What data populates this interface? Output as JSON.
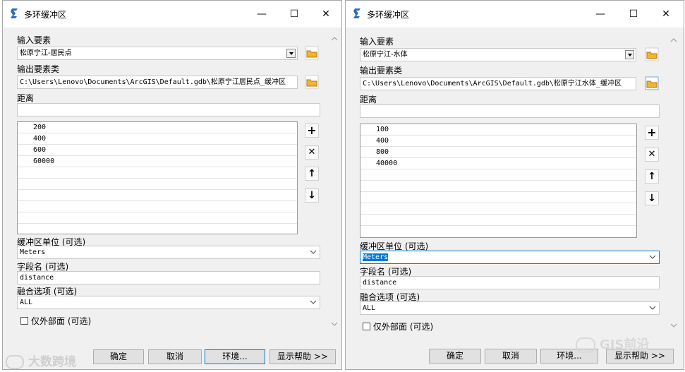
{
  "left": {
    "title": "多环缓冲区",
    "input_label": "输入要素",
    "input_value": "松原宁江-居民点",
    "output_label": "输出要素类",
    "output_value": "C:\\Users\\Lenovo\\Documents\\ArcGIS\\Default.gdb\\松原宁江居民点_缓冲区",
    "distance_label": "距离",
    "distance_value": "",
    "distances": [
      "200",
      "400",
      "600",
      "60000"
    ],
    "unit_label": "缓冲区单位 (可选)",
    "unit_value": "Meters",
    "field_label": "字段名 (可选)",
    "field_value": "distance",
    "dissolve_label": "融合选项 (可选)",
    "dissolve_value": "ALL",
    "outside_only_label": "仅外部面 (可选)",
    "ok": "确定",
    "cancel": "取消",
    "env": "环境...",
    "help": "显示帮助 >>"
  },
  "right": {
    "title": "多环缓冲区",
    "input_label": "输入要素",
    "input_value": "松原宁江-水体",
    "output_label": "输出要素类",
    "output_value": "C:\\Users\\Lenovo\\Documents\\ArcGIS\\Default.gdb\\松原宁江水体_缓冲区",
    "distance_label": "距离",
    "distance_value": "",
    "distances": [
      "100",
      "400",
      "800",
      "40000"
    ],
    "unit_label": "缓冲区单位 (可选)",
    "unit_value": "Meters",
    "field_label": "字段名 (可选)",
    "field_value": "distance",
    "dissolve_label": "融合选项 (可选)",
    "dissolve_value": "ALL",
    "outside_only_label": "仅外部面 (可选)",
    "ok": "确定",
    "cancel": "取消",
    "env": "环境...",
    "help": "显示帮助 >>"
  },
  "window_buttons": {
    "minimize": "—",
    "maximize": "☐",
    "close": "✕"
  },
  "watermark_left": "大数跨境",
  "watermark_right": "GIS前沿",
  "colors": {
    "accent": "#0078d7",
    "dialog_bg": "#f0f0f0"
  }
}
